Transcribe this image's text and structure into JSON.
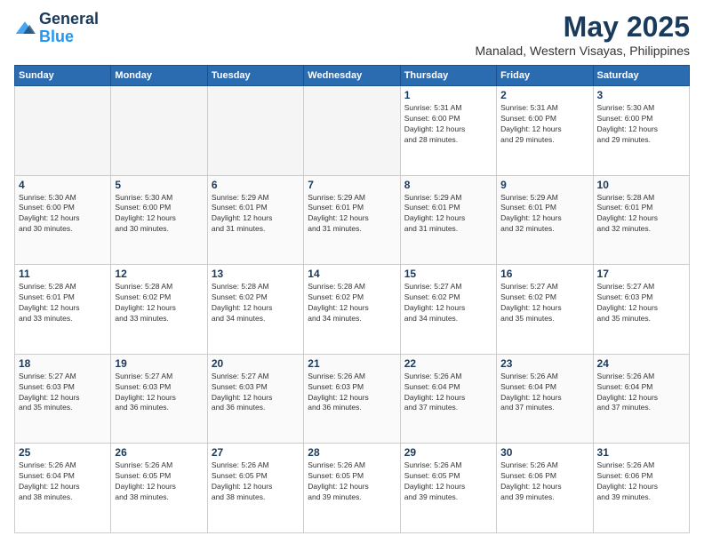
{
  "header": {
    "logo_line1": "General",
    "logo_line2": "Blue",
    "month_title": "May 2025",
    "location": "Manalad, Western Visayas, Philippines"
  },
  "weekdays": [
    "Sunday",
    "Monday",
    "Tuesday",
    "Wednesday",
    "Thursday",
    "Friday",
    "Saturday"
  ],
  "weeks": [
    [
      {
        "day": "",
        "info": ""
      },
      {
        "day": "",
        "info": ""
      },
      {
        "day": "",
        "info": ""
      },
      {
        "day": "",
        "info": ""
      },
      {
        "day": "1",
        "info": "Sunrise: 5:31 AM\nSunset: 6:00 PM\nDaylight: 12 hours\nand 28 minutes."
      },
      {
        "day": "2",
        "info": "Sunrise: 5:31 AM\nSunset: 6:00 PM\nDaylight: 12 hours\nand 29 minutes."
      },
      {
        "day": "3",
        "info": "Sunrise: 5:30 AM\nSunset: 6:00 PM\nDaylight: 12 hours\nand 29 minutes."
      }
    ],
    [
      {
        "day": "4",
        "info": "Sunrise: 5:30 AM\nSunset: 6:00 PM\nDaylight: 12 hours\nand 30 minutes."
      },
      {
        "day": "5",
        "info": "Sunrise: 5:30 AM\nSunset: 6:00 PM\nDaylight: 12 hours\nand 30 minutes."
      },
      {
        "day": "6",
        "info": "Sunrise: 5:29 AM\nSunset: 6:01 PM\nDaylight: 12 hours\nand 31 minutes."
      },
      {
        "day": "7",
        "info": "Sunrise: 5:29 AM\nSunset: 6:01 PM\nDaylight: 12 hours\nand 31 minutes."
      },
      {
        "day": "8",
        "info": "Sunrise: 5:29 AM\nSunset: 6:01 PM\nDaylight: 12 hours\nand 31 minutes."
      },
      {
        "day": "9",
        "info": "Sunrise: 5:29 AM\nSunset: 6:01 PM\nDaylight: 12 hours\nand 32 minutes."
      },
      {
        "day": "10",
        "info": "Sunrise: 5:28 AM\nSunset: 6:01 PM\nDaylight: 12 hours\nand 32 minutes."
      }
    ],
    [
      {
        "day": "11",
        "info": "Sunrise: 5:28 AM\nSunset: 6:01 PM\nDaylight: 12 hours\nand 33 minutes."
      },
      {
        "day": "12",
        "info": "Sunrise: 5:28 AM\nSunset: 6:02 PM\nDaylight: 12 hours\nand 33 minutes."
      },
      {
        "day": "13",
        "info": "Sunrise: 5:28 AM\nSunset: 6:02 PM\nDaylight: 12 hours\nand 34 minutes."
      },
      {
        "day": "14",
        "info": "Sunrise: 5:28 AM\nSunset: 6:02 PM\nDaylight: 12 hours\nand 34 minutes."
      },
      {
        "day": "15",
        "info": "Sunrise: 5:27 AM\nSunset: 6:02 PM\nDaylight: 12 hours\nand 34 minutes."
      },
      {
        "day": "16",
        "info": "Sunrise: 5:27 AM\nSunset: 6:02 PM\nDaylight: 12 hours\nand 35 minutes."
      },
      {
        "day": "17",
        "info": "Sunrise: 5:27 AM\nSunset: 6:03 PM\nDaylight: 12 hours\nand 35 minutes."
      }
    ],
    [
      {
        "day": "18",
        "info": "Sunrise: 5:27 AM\nSunset: 6:03 PM\nDaylight: 12 hours\nand 35 minutes."
      },
      {
        "day": "19",
        "info": "Sunrise: 5:27 AM\nSunset: 6:03 PM\nDaylight: 12 hours\nand 36 minutes."
      },
      {
        "day": "20",
        "info": "Sunrise: 5:27 AM\nSunset: 6:03 PM\nDaylight: 12 hours\nand 36 minutes."
      },
      {
        "day": "21",
        "info": "Sunrise: 5:26 AM\nSunset: 6:03 PM\nDaylight: 12 hours\nand 36 minutes."
      },
      {
        "day": "22",
        "info": "Sunrise: 5:26 AM\nSunset: 6:04 PM\nDaylight: 12 hours\nand 37 minutes."
      },
      {
        "day": "23",
        "info": "Sunrise: 5:26 AM\nSunset: 6:04 PM\nDaylight: 12 hours\nand 37 minutes."
      },
      {
        "day": "24",
        "info": "Sunrise: 5:26 AM\nSunset: 6:04 PM\nDaylight: 12 hours\nand 37 minutes."
      }
    ],
    [
      {
        "day": "25",
        "info": "Sunrise: 5:26 AM\nSunset: 6:04 PM\nDaylight: 12 hours\nand 38 minutes."
      },
      {
        "day": "26",
        "info": "Sunrise: 5:26 AM\nSunset: 6:05 PM\nDaylight: 12 hours\nand 38 minutes."
      },
      {
        "day": "27",
        "info": "Sunrise: 5:26 AM\nSunset: 6:05 PM\nDaylight: 12 hours\nand 38 minutes."
      },
      {
        "day": "28",
        "info": "Sunrise: 5:26 AM\nSunset: 6:05 PM\nDaylight: 12 hours\nand 39 minutes."
      },
      {
        "day": "29",
        "info": "Sunrise: 5:26 AM\nSunset: 6:05 PM\nDaylight: 12 hours\nand 39 minutes."
      },
      {
        "day": "30",
        "info": "Sunrise: 5:26 AM\nSunset: 6:06 PM\nDaylight: 12 hours\nand 39 minutes."
      },
      {
        "day": "31",
        "info": "Sunrise: 5:26 AM\nSunset: 6:06 PM\nDaylight: 12 hours\nand 39 minutes."
      }
    ]
  ]
}
